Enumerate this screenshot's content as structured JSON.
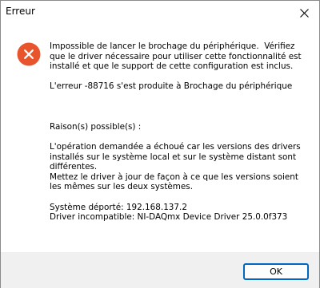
{
  "window": {
    "title": "Erreur",
    "close_icon": "close-icon"
  },
  "dialog": {
    "icon": "error-icon",
    "icon_color": "#e8542c",
    "message": "Impossible de lancer le brochage du périphérique.  Vérifiez\nque le driver nécessaire pour utiliser cette fonctionnalité est\ninstallé et que le support de cette configuration est inclus.\n\nL'erreur -88716 s'est produite à Brochage du périphérique\n\n\n\nRaison(s) possible(s) :\n\nL'opération demandée a échoué car les versions des drivers\ninstallés sur le système local et sur le système distant sont\ndifférentes.\nMettez le driver à jour de façon à ce que les versions soient\nles mêmes sur les deux systèmes.\n\nSystème déporté: 192.168.137.2\nDriver incompatible: NI-DAQmx Device Driver 25.0.0f373"
  },
  "buttons": {
    "ok_label": "OK"
  },
  "colors": {
    "accent": "#0067c0",
    "footer_bg": "#f0f0f0"
  }
}
